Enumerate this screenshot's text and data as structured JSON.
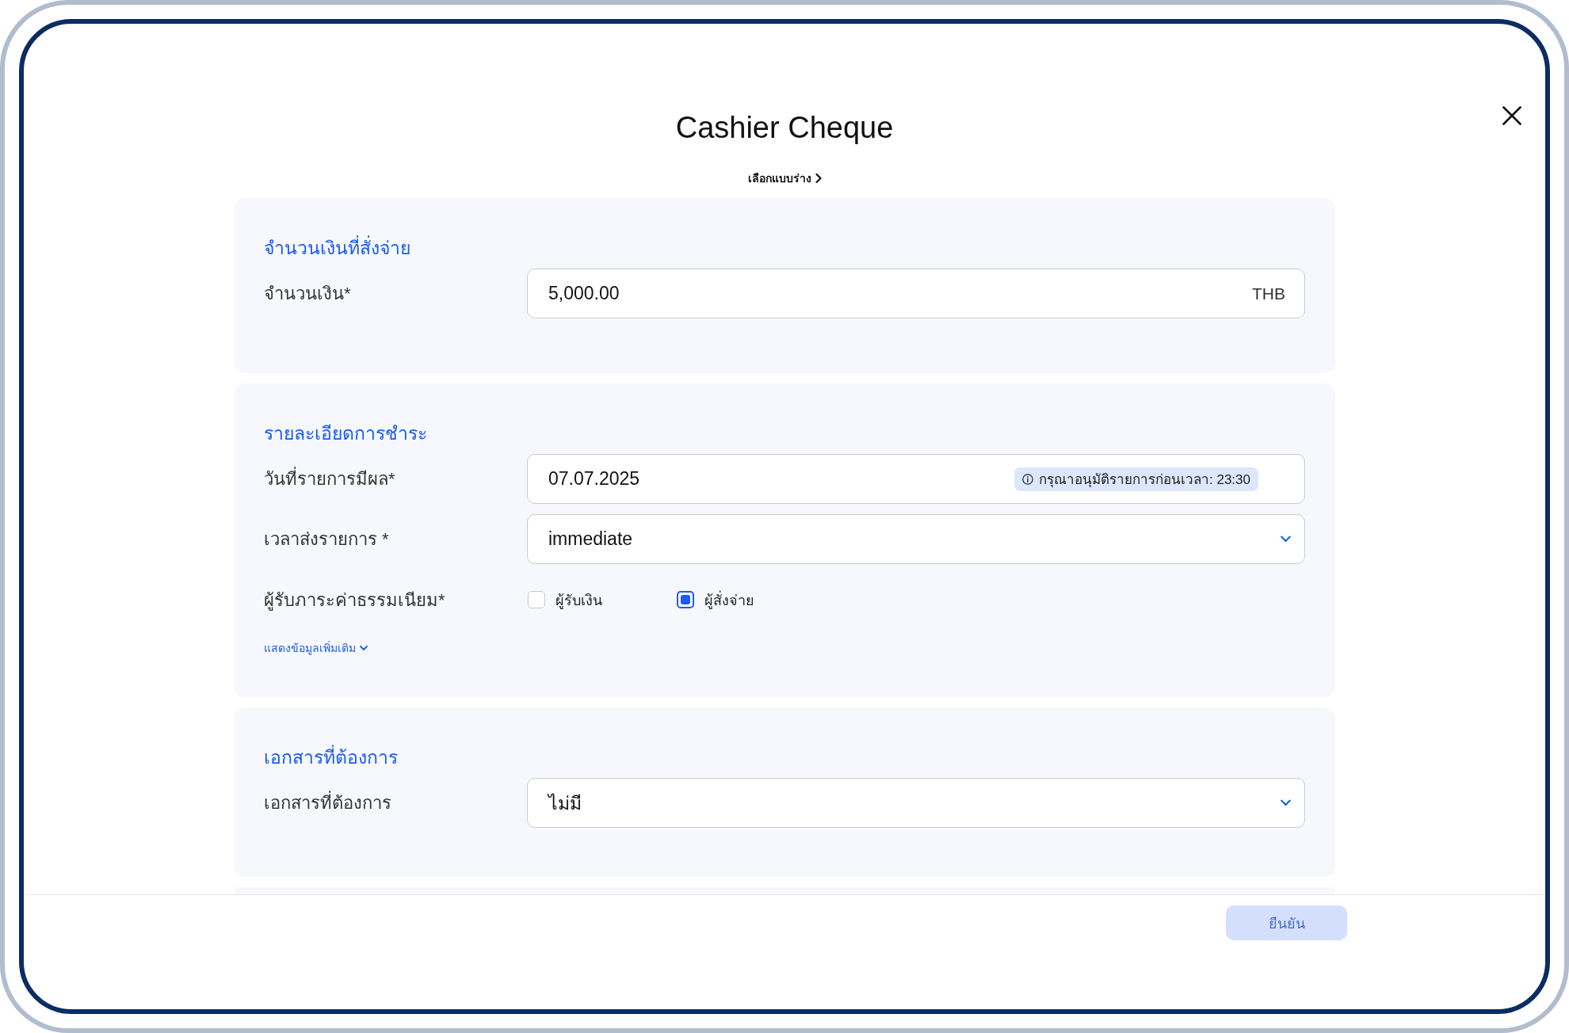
{
  "dialog": {
    "title": "Cashier Cheque",
    "template_link": "เลือกแบบร่าง"
  },
  "sections": [
    {
      "heading": "จำนวนเงินที่สั่งจ่าย",
      "fields": [
        {
          "kind": "text",
          "label": "จำนวนเงิน*",
          "value": "5,000.00",
          "suffix": "THB"
        }
      ]
    },
    {
      "heading": "รายละเอียดการชำระ",
      "fields": [
        {
          "kind": "date",
          "label": "วันที่รายการมีผล*",
          "value": "07.07.2025",
          "hint": "กรุณาอนุมัติรายการก่อนเวลา: 23:30"
        },
        {
          "kind": "select",
          "label": "เวลาส่งรายการ *",
          "value": "immediate"
        },
        {
          "kind": "checkboxes",
          "label": "ผู้รับภาระค่าธรรมเนียม*",
          "options": [
            {
              "label": "ผู้รับเงิน",
              "checked": false
            },
            {
              "label": "ผู้สั่งจ่าย",
              "checked": true
            }
          ]
        }
      ],
      "more_link": "แสดงข้อมูลเพิ่มเติม"
    },
    {
      "heading": "เอกสารที่ต้องการ",
      "fields": [
        {
          "kind": "select",
          "label": "เอกสารที่ต้องการ",
          "value": "ไม่มี"
        }
      ]
    }
  ],
  "footer": {
    "confirm_button": {
      "label": "ยืนยัน",
      "disabled": true
    }
  }
}
